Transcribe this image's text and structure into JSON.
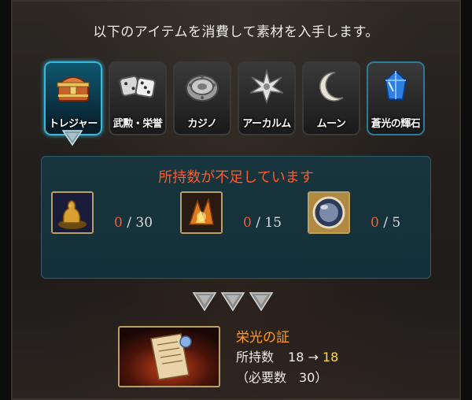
{
  "header": {
    "text": "以下のアイテムを消費して素材を入手します。"
  },
  "tabs": [
    {
      "label": "トレジャー",
      "icon": "treasure-chest-icon",
      "active": true
    },
    {
      "label": "武勲・栄誉",
      "icon": "dice-icon",
      "active": false
    },
    {
      "label": "カジノ",
      "icon": "casino-chip-icon",
      "active": false
    },
    {
      "label": "アーカルム",
      "icon": "star-burst-icon",
      "active": false
    },
    {
      "label": "ムーン",
      "icon": "crescent-moon-icon",
      "active": false
    },
    {
      "label": "蒼光の輝石",
      "icon": "blue-crystal-icon",
      "active": false
    }
  ],
  "shortage": {
    "title": "所持数が不足しています",
    "items": [
      {
        "have": "0",
        "sep": " / ",
        "need": "30",
        "icon": "gold-statue-icon"
      },
      {
        "have": "0",
        "sep": " / ",
        "need": "15",
        "icon": "fire-shard-icon"
      },
      {
        "have": "0",
        "sep": " / ",
        "need": "5",
        "icon": "crystal-orb-icon"
      }
    ]
  },
  "reward": {
    "name": "栄光の証",
    "owned_label": "所持数",
    "owned_from": "18",
    "arrow": "→",
    "owned_to": "18",
    "required_text": "（必要数　30）",
    "icon": "scroll-icon"
  },
  "colors": {
    "accent_active": "#3ab7d6",
    "warning": "#ff5a2a",
    "reward_name": "#ff9a2a",
    "highlight": "#ffd84a"
  }
}
